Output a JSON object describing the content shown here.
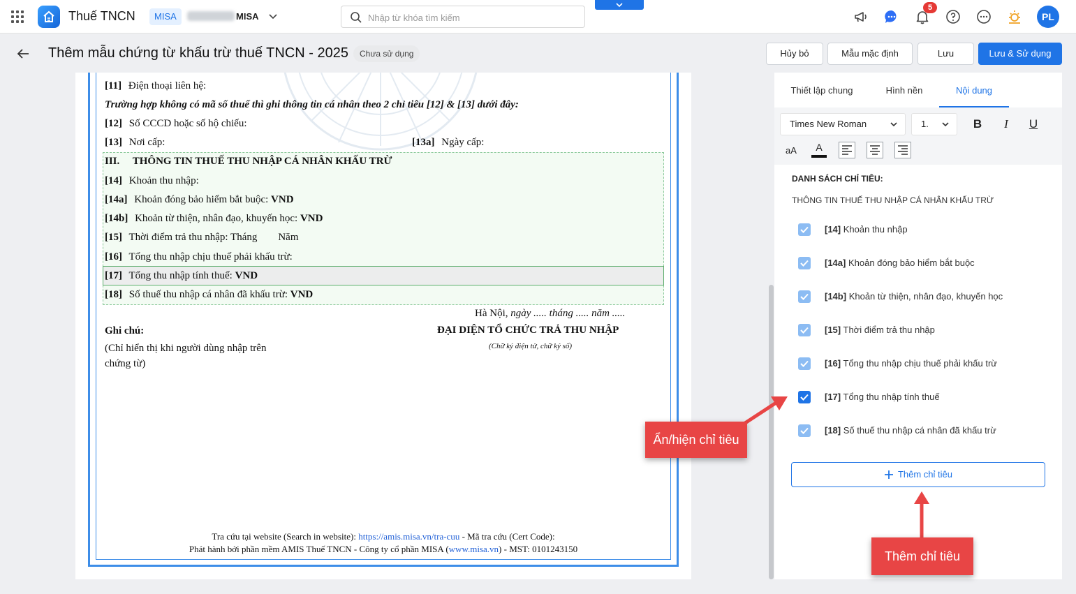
{
  "topbar": {
    "app_name": "Thuế TNCN",
    "org_tag": "MISA",
    "org_name": "MISA",
    "search_placeholder": "Nhập từ khóa tìm kiếm",
    "notification_count": "5",
    "avatar_initials": "PL"
  },
  "header": {
    "title": "Thêm mẫu chứng từ khấu trừ thuế TNCN - 2025",
    "status": "Chưa sử dụng",
    "buttons": {
      "cancel": "Hủy bỏ",
      "default_template": "Mẫu mặc định",
      "save": "Lưu",
      "save_use": "Lưu & Sử dụng"
    }
  },
  "document": {
    "line_11": {
      "code": "[11]",
      "text": "Điện thoại liên hệ:"
    },
    "italic_note": "Trường hợp không có mã số thuế thì ghi thông tin cá nhân theo 2 chỉ tiêu [12] & [13] dưới đây:",
    "line_12": {
      "code": "[12]",
      "text": "Số CCCD hoặc số hộ chiếu:"
    },
    "line_13": {
      "code": "[13]",
      "text": "Nơi cấp:"
    },
    "line_13a": {
      "code": "[13a]",
      "text": "Ngày cấp:"
    },
    "section_title": "III.     THÔNG TIN THUẾ THU NHẬP CÁ NHÂN KHẤU TRỪ",
    "line_14": {
      "code": "[14]",
      "text": "Khoản thu nhập:"
    },
    "line_14a": {
      "code": "[14a]",
      "text": "Khoản đóng bảo hiểm bắt buộc: ",
      "unit": "VND"
    },
    "line_14b": {
      "code": "[14b]",
      "text": "Khoản từ thiện, nhân đạo, khuyến học: ",
      "unit": "VND"
    },
    "line_15": {
      "code": "[15]",
      "text": "Thời điểm trả thu nhập: Tháng        Năm"
    },
    "line_16": {
      "code": "[16]",
      "text": "Tổng thu nhập chịu thuế phải khấu trừ:"
    },
    "line_17": {
      "code": "[17]",
      "text": "Tổng thu nhập tính thuế: ",
      "unit": "VND"
    },
    "line_18": {
      "code": "[18]",
      "text": "Số thuế thu nhập cá nhân đã khấu trừ: ",
      "unit": "VND"
    },
    "place": "Hà Nội",
    "date_text": ", ngày ..... tháng ..... năm .....",
    "signer_title": "ĐẠI DIỆN TỔ CHỨC TRẢ THU NHẬP",
    "signer_note": "(Chữ ký điện tử, chữ ký số)",
    "note_title": "Ghi chú:",
    "note_body": "(Chỉ hiển thị khi người dùng nhập trên chứng từ)",
    "footer_lookup_prefix": "Tra cứu tại website (Search in website): ",
    "footer_lookup_link": "https://amis.misa.vn/tra-cuu",
    "footer_lookup_suffix": "  - Mã tra cứu (Cert Code):",
    "footer_publisher_prefix": "Phát hành bởi phần mềm AMIS Thuế TNCN - Công ty cổ phần MISA (",
    "footer_publisher_link": "www.misa.vn",
    "footer_publisher_suffix": ") - MST: 0101243150"
  },
  "panel": {
    "tabs": [
      "Thiết lập chung",
      "Hình nền",
      "Nội dung"
    ],
    "active_tab": "Nội dung",
    "font_family": "Times New Roman",
    "font_size": "1.",
    "format": {
      "bold": "B",
      "italic": "I",
      "underline": "U",
      "case": "aA",
      "color": "A"
    },
    "list_heading": "DANH SÁCH CHỈ TIÊU:",
    "list_subheading": "THÔNG TIN THUẾ THU NHẬP CÁ NHÂN KHẤU TRỪ",
    "criteria": [
      {
        "code": "[14]",
        "label": "Khoản thu nhập",
        "checked": true
      },
      {
        "code": "[14a]",
        "label": "Khoản đóng bảo hiểm bắt buộc",
        "checked": true
      },
      {
        "code": "[14b]",
        "label": "Khoản từ thiện, nhân đạo, khuyến học",
        "checked": true
      },
      {
        "code": "[15]",
        "label": "Thời điểm trả thu nhập",
        "checked": true
      },
      {
        "code": "[16]",
        "label": "Tổng thu nhập chịu thuế phải khấu trừ",
        "checked": true
      },
      {
        "code": "[17]",
        "label": "Tổng thu nhập tính thuế",
        "checked": true
      },
      {
        "code": "[18]",
        "label": "Số thuế thu nhập cá nhân đã khấu trừ",
        "checked": true
      }
    ],
    "add_button": "Thêm chỉ tiêu"
  },
  "callouts": {
    "toggle": "Ẩn/hiện chỉ tiêu",
    "add": "Thêm chỉ tiêu"
  },
  "colors": {
    "accent": "#1f74e6",
    "callout": "#e84545",
    "section_bg": "#f3fbf3",
    "badge": "#e53935"
  }
}
